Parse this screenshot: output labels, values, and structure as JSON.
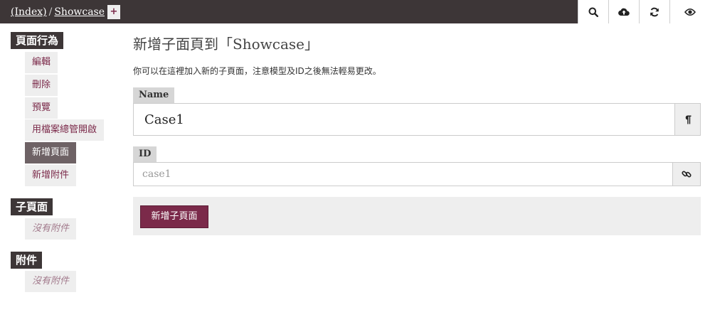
{
  "breadcrumb": {
    "index_link": "(Index)",
    "separator": "/",
    "page_link": "Showcase"
  },
  "topbar": {
    "add_button": "+"
  },
  "toolbar": [
    "search-icon",
    "cloud-upload-icon",
    "refresh-icon",
    "eye-icon"
  ],
  "sidebar": {
    "actions_heading": "頁面行為",
    "actions": [
      {
        "label": "編輯"
      },
      {
        "label": "刪除"
      },
      {
        "label": "預覽"
      },
      {
        "label": "用檔案總管開啟"
      },
      {
        "label": "新增頁面",
        "active": true
      },
      {
        "label": "新增附件"
      }
    ],
    "subpages_heading": "子頁面",
    "subpages_empty": "沒有附件",
    "attachments_heading": "附件",
    "attachments_empty": "沒有附件"
  },
  "main": {
    "title": "新增子面頁到「Showcase」",
    "description": "你可以在這裡加入新的子頁面，注意模型及ID之後無法輕易更改。",
    "name_label": "Name",
    "name_value": "Case1",
    "name_button_icon": "pilcrow-icon",
    "id_label": "ID",
    "id_placeholder": "case1",
    "id_button_icon": "link-icon",
    "submit_label": "新增子頁面"
  },
  "colors": {
    "topbar": "#3d3637",
    "accent": "#7b2a4a",
    "sidebar_item_bg": "#eeeeee",
    "active_item_bg": "#6e6265"
  }
}
